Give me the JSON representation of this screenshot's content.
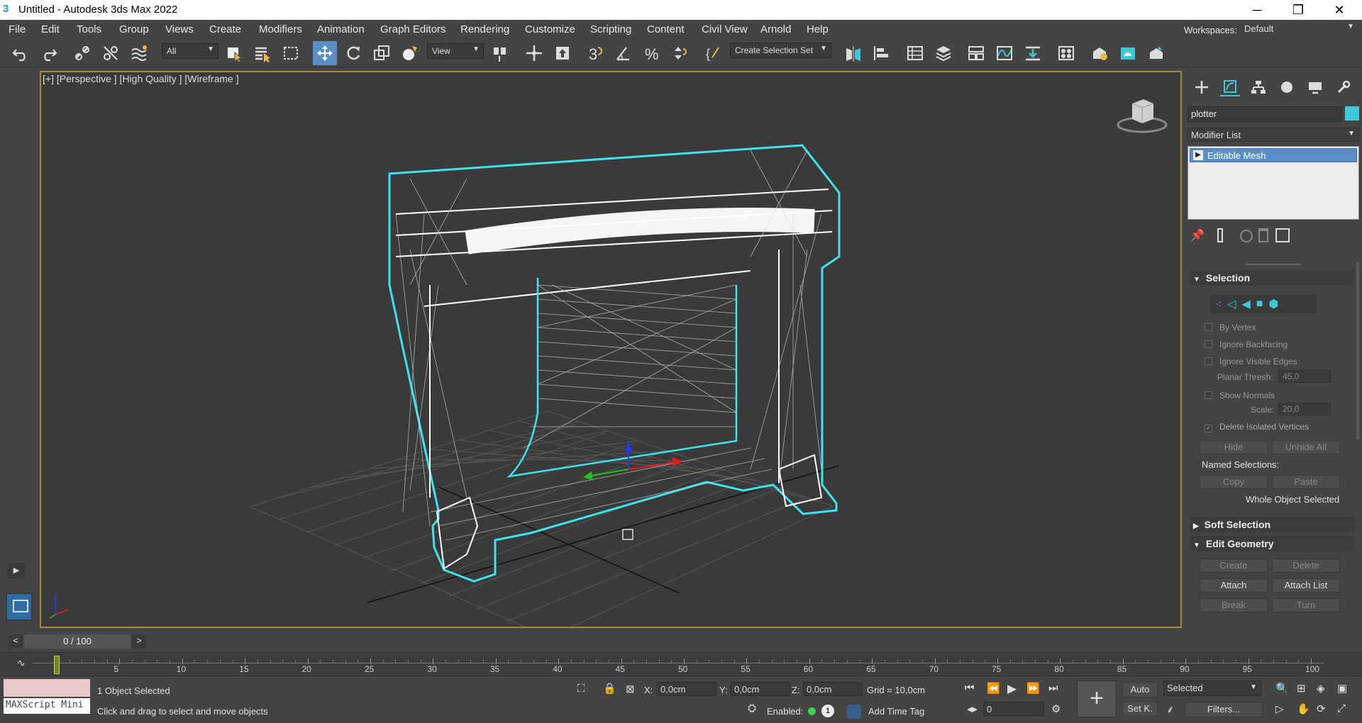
{
  "window": {
    "title": "Untitled - Autodesk 3ds Max 2022",
    "minimize": "─",
    "restore": "❐",
    "close": "✕"
  },
  "menu": [
    "File",
    "Edit",
    "Tools",
    "Group",
    "Views",
    "Create",
    "Modifiers",
    "Animation",
    "Graph Editors",
    "Rendering",
    "Customize",
    "Scripting",
    "Content",
    "Civil View",
    "Arnold",
    "Help"
  ],
  "workspaces": {
    "label": "Workspaces:",
    "value": "Default"
  },
  "toolbar": {
    "filter": "All",
    "refcoord": "View",
    "selset": "Create Selection Set",
    "snap_label": "3",
    "percent_label": "%"
  },
  "viewport": {
    "label": "[+] [Perspective ] [High Quality ] [Wireframe ]"
  },
  "panel": {
    "object_name": "plotter",
    "object_color": "#3ec8d8",
    "modifier_list": "Modifier List",
    "stack_item": "Editable Mesh",
    "selection": {
      "header": "Selection",
      "by_vertex": "By Vertex",
      "ignore_backfacing": "Ignore Backfacing",
      "ignore_visible_edges": "Ignore Visible Edges",
      "planar_thresh_label": "Planar Thresh:",
      "planar_thresh": "45,0",
      "show_normals": "Show Normals",
      "scale_label": "Scale:",
      "scale": "20,0",
      "delete_isolated": "Delete Isolated Vertices",
      "delete_isolated_checked": "✓",
      "hide": "Hide",
      "unhide_all": "Unhide All",
      "named_selections": "Named Selections:",
      "copy": "Copy",
      "paste": "Paste",
      "whole_object": "Whole Object Selected"
    },
    "soft_selection": "Soft Selection",
    "edit_geometry": {
      "header": "Edit Geometry",
      "create": "Create",
      "delete": "Delete",
      "attach": "Attach",
      "attach_list": "Attach List",
      "break": "Break",
      "turn": "Turn"
    }
  },
  "timeslider": {
    "value": "0 / 100",
    "prev": "<",
    "next": ">"
  },
  "timeline": {
    "ticks": [
      "5",
      "10",
      "15",
      "20",
      "25",
      "30",
      "35",
      "40",
      "45",
      "50",
      "55",
      "60",
      "65",
      "70",
      "75",
      "80",
      "85",
      "90",
      "95",
      "100"
    ]
  },
  "status": {
    "maxscript": "MAXScript Mini",
    "selected": "1 Object Selected",
    "prompt": "Click and drag to select and move objects",
    "x_label": "X:",
    "x": "0,0cm",
    "y_label": "Y:",
    "y": "0,0cm",
    "z_label": "Z:",
    "z": "0,0cm",
    "grid": "Grid = 10,0cm",
    "enabled_label": "Enabled:",
    "add_time_tag": "Add Time Tag",
    "auto_key": "Auto",
    "set_key": "Set K.",
    "key_filter": "Selected",
    "filters": "Filters...",
    "frame": "0",
    "frame_badge": "1"
  }
}
